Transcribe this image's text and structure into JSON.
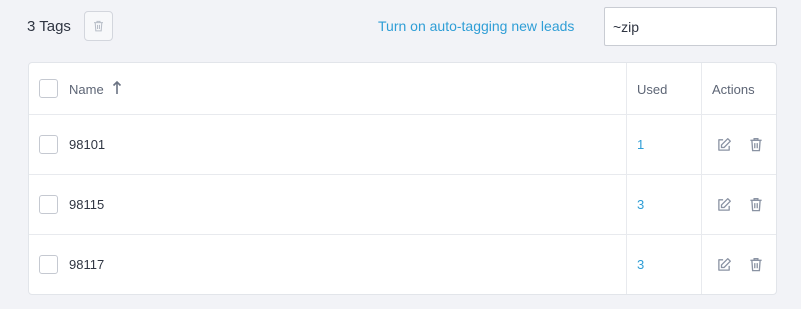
{
  "toolbar": {
    "tag_count": "3 Tags",
    "autotag_link": "Turn on auto-tagging new leads",
    "search_value": "~zip",
    "delete_icon": "trash-icon"
  },
  "table": {
    "columns": {
      "name": "Name",
      "used": "Used",
      "actions": "Actions"
    },
    "sort": {
      "column": "Name",
      "direction": "ascending",
      "icon": "arrow-up-icon"
    },
    "rows": [
      {
        "name": "98101",
        "used": "1"
      },
      {
        "name": "98115",
        "used": "3"
      },
      {
        "name": "98117",
        "used": "3"
      }
    ],
    "row_action_icons": [
      "edit-icon",
      "trash-icon"
    ]
  },
  "colors": {
    "accent": "#2f9ed6",
    "background": "#f2f3f7",
    "text": "#2f3542",
    "icon": "#8a93a3"
  }
}
